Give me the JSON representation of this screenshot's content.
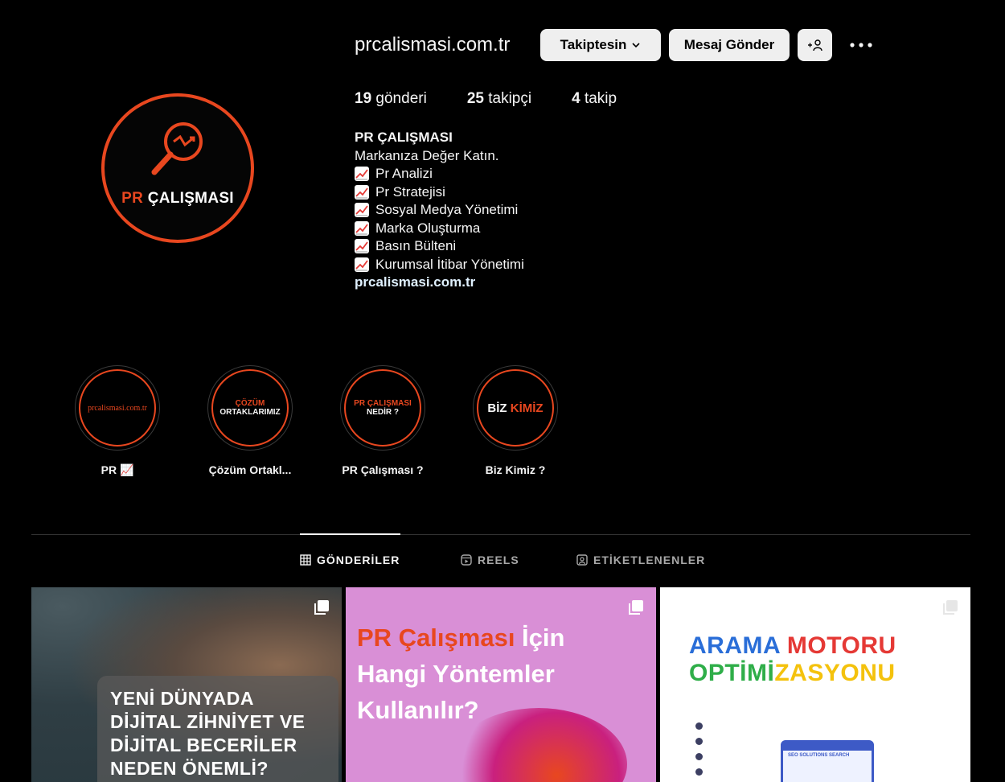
{
  "profile": {
    "username": "prcalismasi.com.tr",
    "follow_button": "Takiptesin",
    "message_button": "Mesaj Gönder",
    "avatar": {
      "brand_pr": "PR",
      "brand_rest": "ÇALIŞMASI"
    },
    "stats": [
      {
        "count": "19",
        "label": "gönderi"
      },
      {
        "count": "25",
        "label": "takipçi"
      },
      {
        "count": "4",
        "label": "takip"
      }
    ],
    "bio": {
      "name": "PR ÇALIŞMASI",
      "tagline": "Markanıza Değer Katın.",
      "services": [
        "Pr Analizi",
        "Pr Stratejisi",
        "Sosyal Medya Yönetimi",
        "Marka Oluşturma",
        "Basın Bülteni",
        "Kurumsal İtibar Yönetimi"
      ],
      "link": "prcalismasi.com.tr"
    }
  },
  "highlights": [
    {
      "label": "PR 📈",
      "cover_text": "prcalismasi.com.tr"
    },
    {
      "label": "Çözüm Ortakl...",
      "cover_line1": "ÇÖZÜM",
      "cover_line2": "ORTAKLARIMIZ"
    },
    {
      "label": "PR Çalışması ?",
      "cover_line1": "PR ÇALIŞMASI",
      "cover_line2": "NEDİR ?"
    },
    {
      "label": "Biz Kimiz ?",
      "cover_word1": "BİZ",
      "cover_word2": "KİMİZ"
    }
  ],
  "tabs": [
    {
      "label": "GÖNDERİLER",
      "icon": "grid-icon",
      "active": true
    },
    {
      "label": "REELS",
      "icon": "reels-icon",
      "active": false
    },
    {
      "label": "ETİKETLENENLER",
      "icon": "tagged-icon",
      "active": false
    }
  ],
  "posts": [
    {
      "title": "YENİ DÜNYADA DİJİTAL ZİHNİYET VE DİJİTAL BECERİLER NEDEN ÖNEMLİ?"
    },
    {
      "title_orange": "PR Çalışması",
      "title_rest_1": " İçin",
      "title_line2": "Hangi Yöntemler",
      "title_line3": "Kullanılır?"
    },
    {
      "title_w1": "ARAMA",
      "title_w2": "MOTORU",
      "title_w3a": "OPTİMİ",
      "title_w3b": "ZASYONU",
      "screen_text": "SEO SOLUTIONS SEARCH"
    }
  ],
  "colors": {
    "accent": "#e8471f",
    "background": "#000000",
    "button": "#efefef"
  }
}
